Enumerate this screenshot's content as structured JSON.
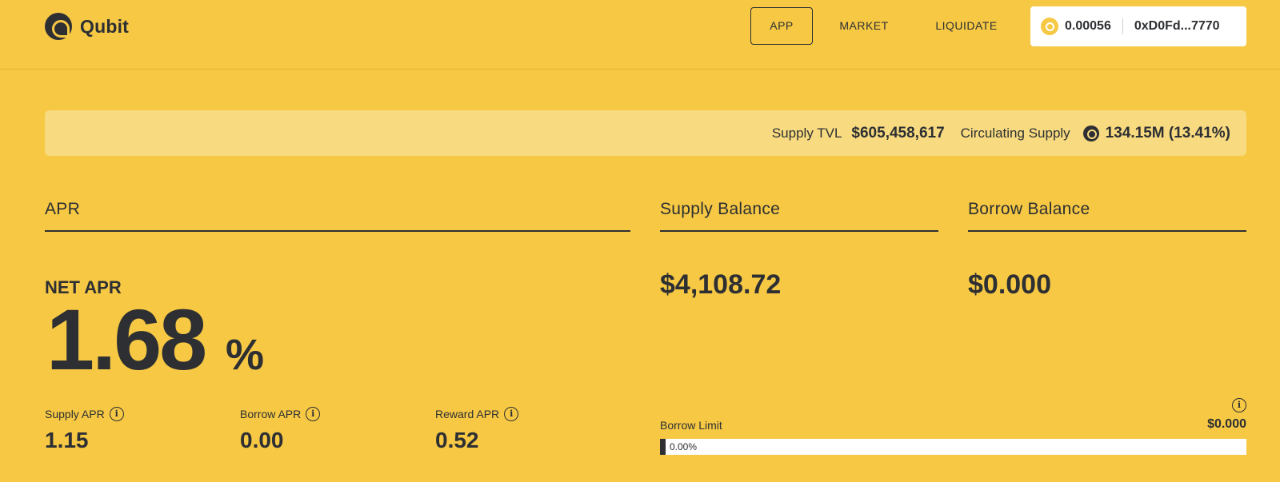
{
  "brand": {
    "name": "Qubit"
  },
  "nav": {
    "app": "APP",
    "market": "MARKET",
    "liquidate": "LIQUIDATE"
  },
  "wallet": {
    "balance": "0.00056",
    "address": "0xD0Fd...7770"
  },
  "stats": {
    "supply_tvl_label": "Supply TVL",
    "supply_tvl_value": "$605,458,617",
    "circulating_label": "Circulating Supply",
    "circulating_value": "134.15M (13.41%)"
  },
  "apr": {
    "title": "APR",
    "net_label": "NET APR",
    "net_value": "1.68",
    "net_unit": "%",
    "supply_label": "Supply APR",
    "supply_value": "1.15",
    "borrow_label": "Borrow APR",
    "borrow_value": "0.00",
    "reward_label": "Reward APR",
    "reward_value": "0.52"
  },
  "balances": {
    "supply_title": "Supply Balance",
    "supply_value": "$4,108.72",
    "borrow_title": "Borrow Balance",
    "borrow_value": "$0.000"
  },
  "borrow_limit": {
    "label": "Borrow Limit",
    "amount": "$0.000",
    "percent_text": "0.00%",
    "percent": 0
  },
  "colors": {
    "background": "#f6c843",
    "text": "#2d2f33",
    "stats_bar": "#f8db80"
  }
}
